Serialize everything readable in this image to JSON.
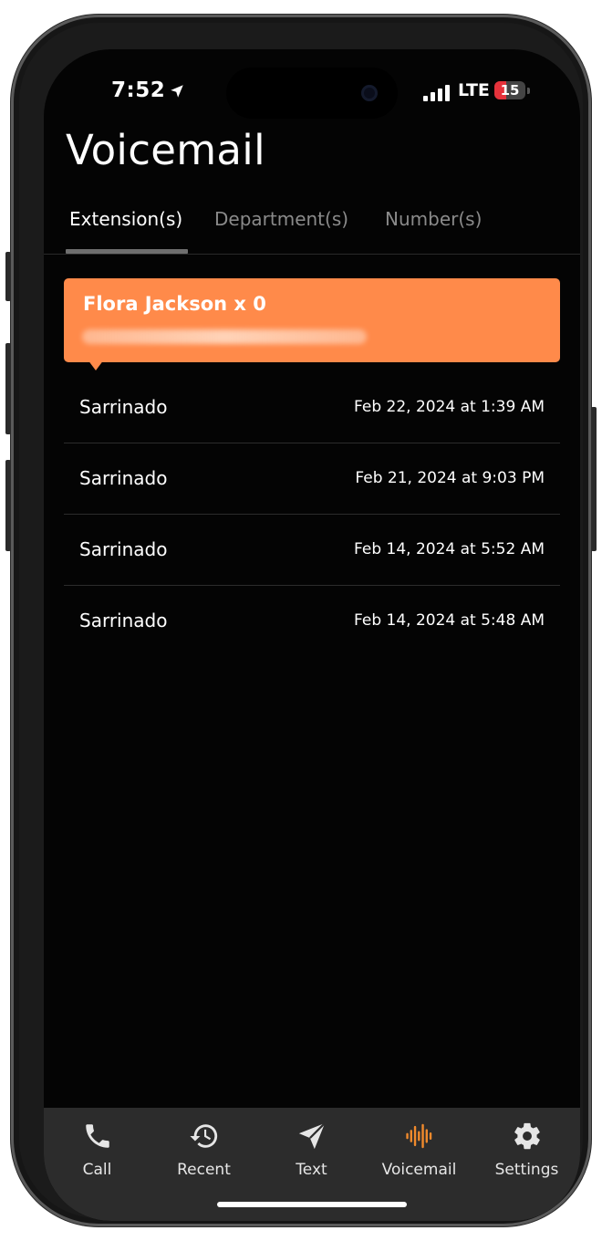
{
  "status_bar": {
    "time": "7:52",
    "network": "LTE",
    "battery": "15"
  },
  "header": {
    "title": "Voicemail"
  },
  "tabs": [
    {
      "label": "Extension(s)",
      "active": true
    },
    {
      "label": "Department(s)",
      "active": false
    },
    {
      "label": "Number(s)",
      "active": false
    }
  ],
  "banner": {
    "name": "Flora Jackson x 0",
    "color": "#ff8a4a"
  },
  "voicemails": [
    {
      "name": "Sarrinado",
      "date": "Feb 22, 2024 at 1:39 AM"
    },
    {
      "name": "Sarrinado",
      "date": "Feb 21, 2024 at 9:03 PM"
    },
    {
      "name": "Sarrinado",
      "date": "Feb 14, 2024 at 5:52 AM"
    },
    {
      "name": "Sarrinado",
      "date": "Feb 14, 2024 at 5:48 AM"
    }
  ],
  "tab_bar": [
    {
      "label": "Call",
      "icon": "phone-icon"
    },
    {
      "label": "Recent",
      "icon": "history-icon"
    },
    {
      "label": "Text",
      "icon": "send-icon"
    },
    {
      "label": "Voicemail",
      "icon": "waveform-icon",
      "active": true
    },
    {
      "label": "Settings",
      "icon": "gear-icon"
    }
  ],
  "colors": {
    "accent": "#ff8a4a",
    "active_icon": "#f08a2c",
    "background": "#040404"
  }
}
